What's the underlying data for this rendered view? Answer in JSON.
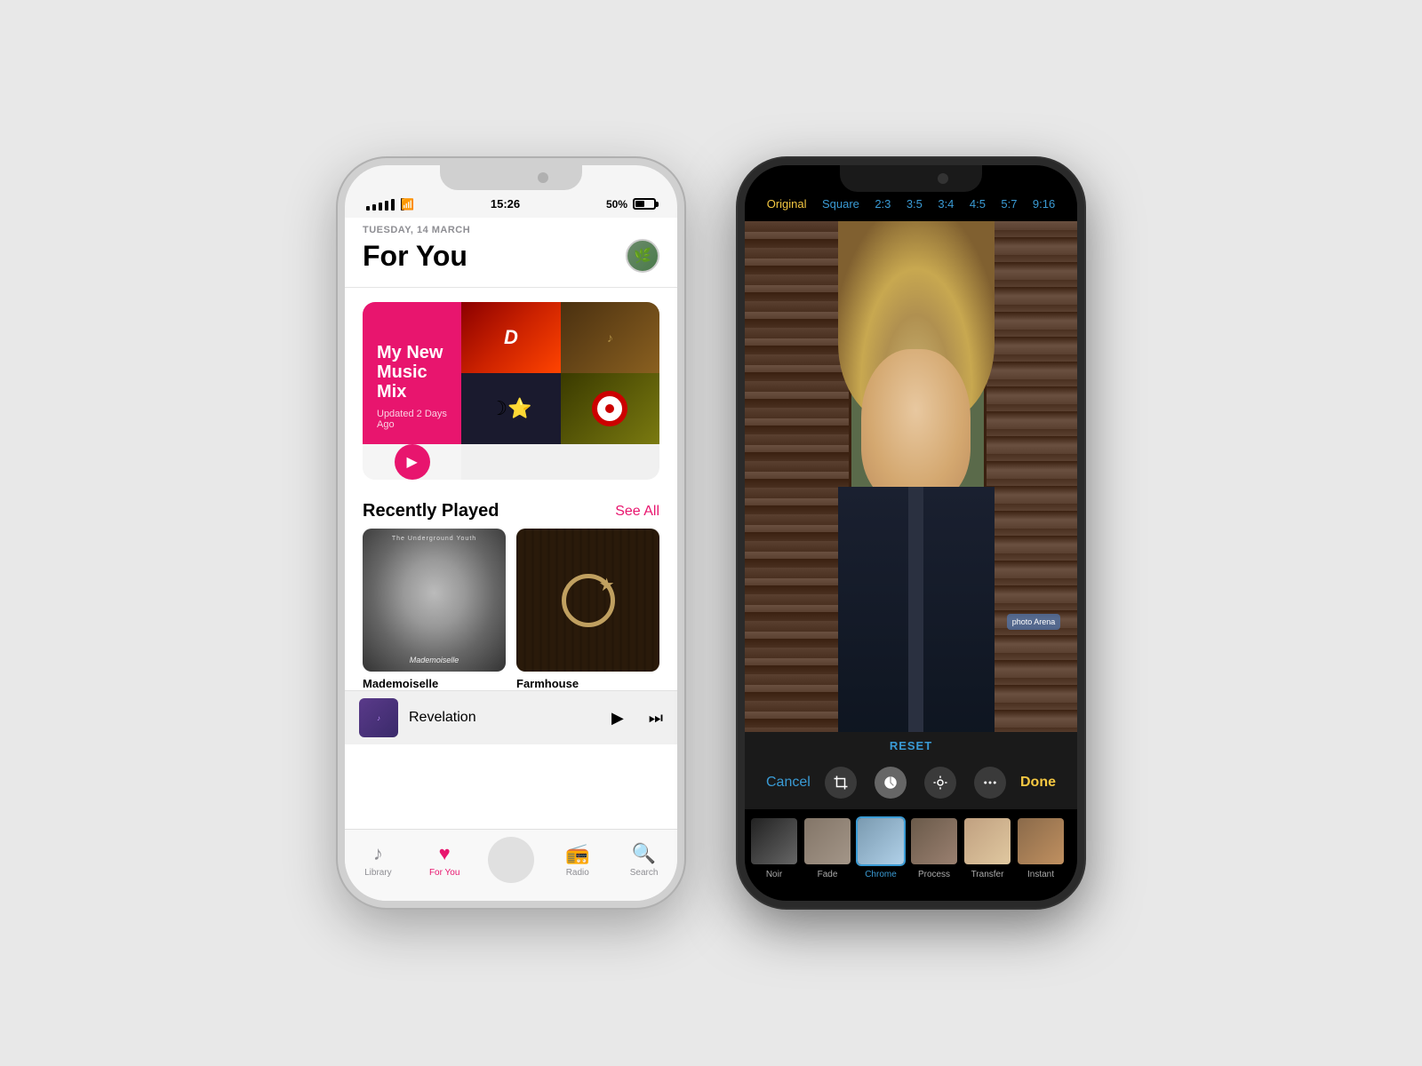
{
  "left_phone": {
    "status_bar": {
      "time": "15:26",
      "battery": "50%"
    },
    "header": {
      "date": "TUESDAY, 14 MARCH",
      "title": "For You"
    },
    "mix_card": {
      "title": "My New Music Mix",
      "updated": "Updated 2 Days Ago"
    },
    "recently_played": {
      "section_title": "Recently Played",
      "see_all": "See All",
      "items": [
        {
          "title": "Mademoiselle",
          "artist": "The Underground Youth"
        },
        {
          "title": "Farmhouse",
          "artist": ""
        }
      ]
    },
    "now_playing": {
      "title": "Revelation"
    },
    "tab_bar": {
      "items": [
        {
          "label": "Library",
          "icon": "♪"
        },
        {
          "label": "For You",
          "icon": "♥",
          "active": true
        },
        {
          "label": "",
          "icon": ""
        },
        {
          "label": "Radio",
          "icon": "◉"
        },
        {
          "label": "Search",
          "icon": "⌕"
        }
      ]
    }
  },
  "right_phone": {
    "crop_options": [
      "Original",
      "Square",
      "2:3",
      "3:5",
      "3:4",
      "4:5",
      "5:7",
      "9:16"
    ],
    "active_crop": "Original",
    "watermark": "photo Arena",
    "reset_label": "RESET",
    "toolbar": {
      "cancel": "Cancel",
      "done": "Done"
    },
    "filters": [
      {
        "label": "Noir",
        "active": false
      },
      {
        "label": "Fade",
        "active": false
      },
      {
        "label": "Chrome",
        "active": true
      },
      {
        "label": "Process",
        "active": false
      },
      {
        "label": "Transfer",
        "active": false
      },
      {
        "label": "Instant",
        "active": false
      }
    ]
  }
}
